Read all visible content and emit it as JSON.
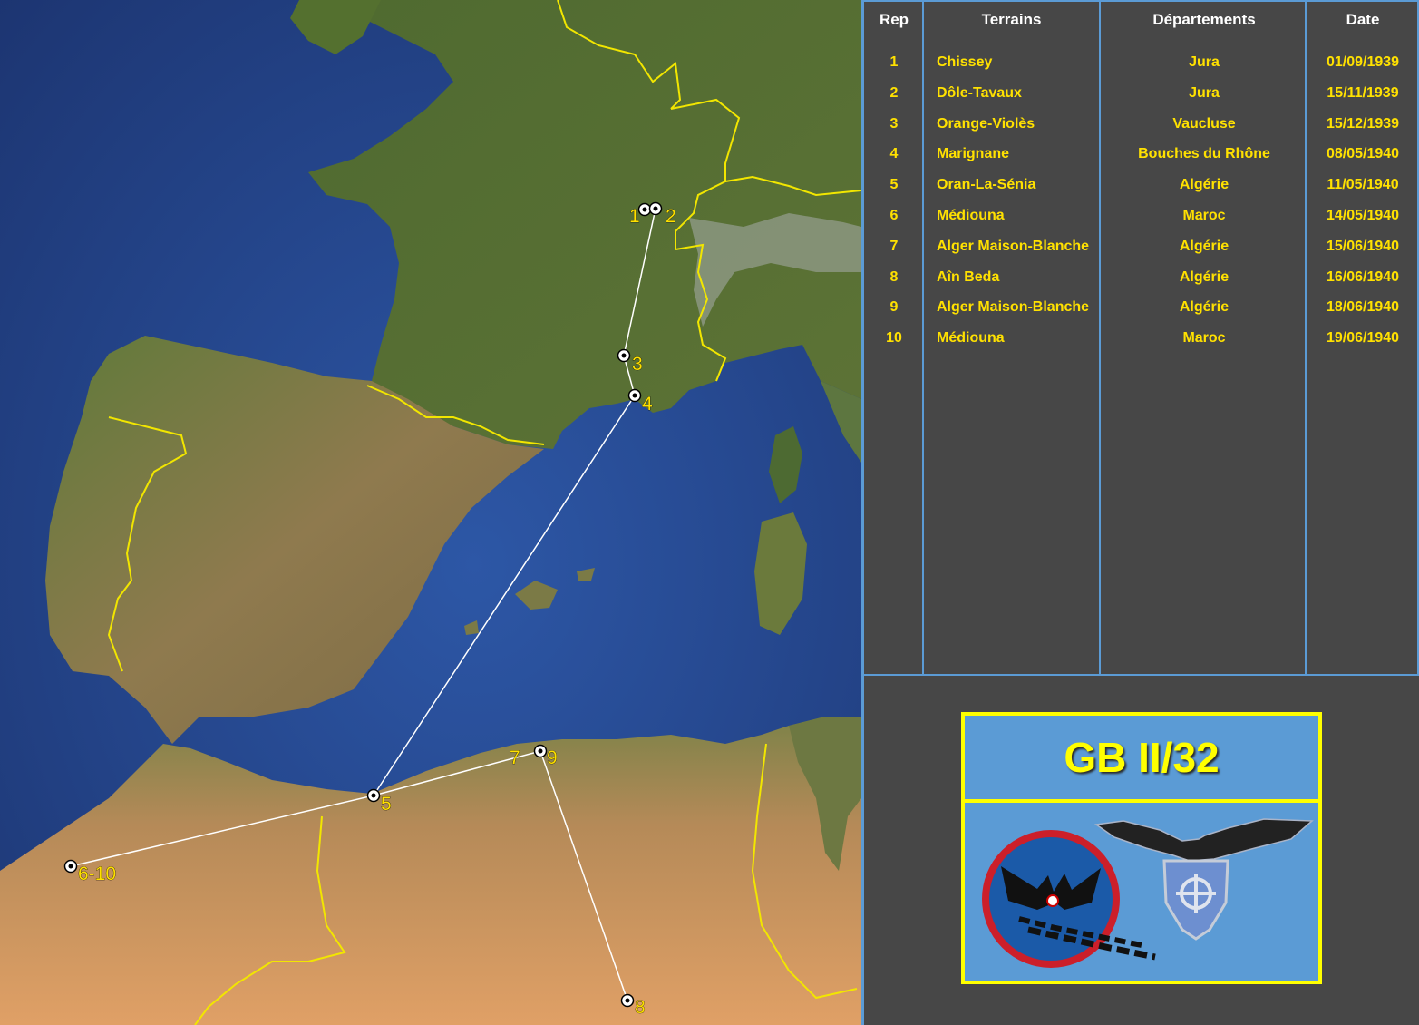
{
  "map": {
    "markers": [
      {
        "label": "1"
      },
      {
        "label": "2"
      },
      {
        "label": "3"
      },
      {
        "label": "4"
      },
      {
        "label": "5"
      },
      {
        "label": "6-10"
      },
      {
        "label": "7"
      },
      {
        "label": "9"
      },
      {
        "label": "8"
      }
    ],
    "colors": {
      "sea": "#2b4f93",
      "land_green": "#5c7238",
      "desert": "#d59a5c",
      "border": "#f2e600",
      "route": "#ffffff",
      "label": "#ffe100"
    }
  },
  "table": {
    "headers": {
      "rep": "Rep",
      "terrains": "Terrains",
      "departements": "Départements",
      "date": "Date"
    },
    "rows": [
      {
        "rep": "1",
        "terrain": "Chissey",
        "departement": "Jura",
        "date": "01/09/1939"
      },
      {
        "rep": "2",
        "terrain": "Dôle-Tavaux",
        "departement": "Jura",
        "date": "15/11/1939"
      },
      {
        "rep": "3",
        "terrain": "Orange-Violès",
        "departement": "Vaucluse",
        "date": "15/12/1939"
      },
      {
        "rep": "4",
        "terrain": "Marignane",
        "departement": "Bouches du Rhône",
        "date": "08/05/1940"
      },
      {
        "rep": "5",
        "terrain": "Oran-La-Sénia",
        "departement": "Algérie",
        "date": "11/05/1940"
      },
      {
        "rep": "6",
        "terrain": "Médiouna",
        "departement": "Maroc",
        "date": "14/05/1940"
      },
      {
        "rep": "7",
        "terrain": "Alger Maison-Blanche",
        "departement": "Algérie",
        "date": "15/06/1940"
      },
      {
        "rep": "8",
        "terrain": "Aîn Beda",
        "departement": "Algérie",
        "date": "16/06/1940"
      },
      {
        "rep": "9",
        "terrain": "Alger Maison-Blanche",
        "departement": "Algérie",
        "date": "18/06/1940"
      },
      {
        "rep": "10",
        "terrain": "Médiouna",
        "departement": "Maroc",
        "date": "19/06/1940"
      }
    ],
    "colors": {
      "text": "#ffe100",
      "header": "#ffffff",
      "grid": "#5b9bd5",
      "background": "#474747"
    }
  },
  "unit": {
    "title": "GB II/32",
    "insignia": [
      "red-ring-eagle-badge",
      "winged-shield-badge"
    ]
  }
}
